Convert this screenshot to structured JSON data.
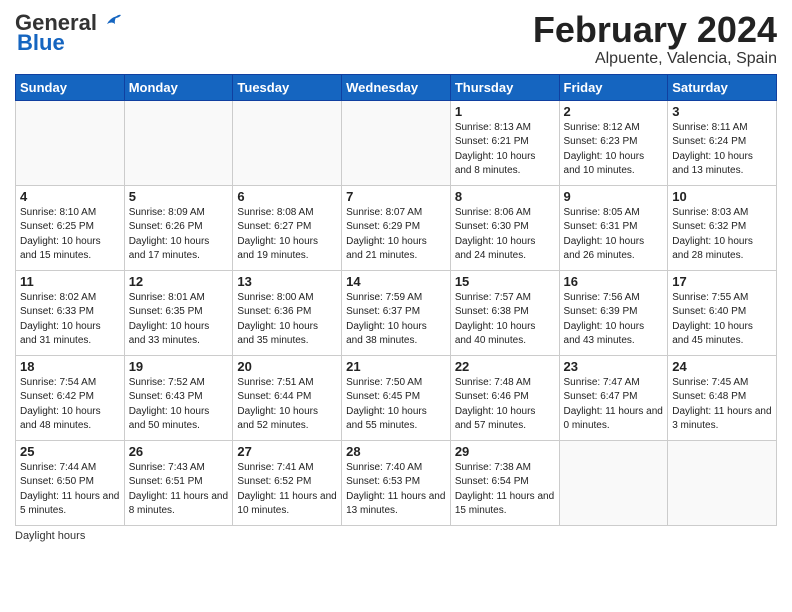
{
  "logo": {
    "general": "General",
    "blue": "Blue"
  },
  "title": "February 2024",
  "subtitle": "Alpuente, Valencia, Spain",
  "days_of_week": [
    "Sunday",
    "Monday",
    "Tuesday",
    "Wednesday",
    "Thursday",
    "Friday",
    "Saturday"
  ],
  "weeks": [
    [
      {
        "day": "",
        "info": ""
      },
      {
        "day": "",
        "info": ""
      },
      {
        "day": "",
        "info": ""
      },
      {
        "day": "",
        "info": ""
      },
      {
        "day": "1",
        "info": "Sunrise: 8:13 AM\nSunset: 6:21 PM\nDaylight: 10 hours and 8 minutes."
      },
      {
        "day": "2",
        "info": "Sunrise: 8:12 AM\nSunset: 6:23 PM\nDaylight: 10 hours and 10 minutes."
      },
      {
        "day": "3",
        "info": "Sunrise: 8:11 AM\nSunset: 6:24 PM\nDaylight: 10 hours and 13 minutes."
      }
    ],
    [
      {
        "day": "4",
        "info": "Sunrise: 8:10 AM\nSunset: 6:25 PM\nDaylight: 10 hours and 15 minutes."
      },
      {
        "day": "5",
        "info": "Sunrise: 8:09 AM\nSunset: 6:26 PM\nDaylight: 10 hours and 17 minutes."
      },
      {
        "day": "6",
        "info": "Sunrise: 8:08 AM\nSunset: 6:27 PM\nDaylight: 10 hours and 19 minutes."
      },
      {
        "day": "7",
        "info": "Sunrise: 8:07 AM\nSunset: 6:29 PM\nDaylight: 10 hours and 21 minutes."
      },
      {
        "day": "8",
        "info": "Sunrise: 8:06 AM\nSunset: 6:30 PM\nDaylight: 10 hours and 24 minutes."
      },
      {
        "day": "9",
        "info": "Sunrise: 8:05 AM\nSunset: 6:31 PM\nDaylight: 10 hours and 26 minutes."
      },
      {
        "day": "10",
        "info": "Sunrise: 8:03 AM\nSunset: 6:32 PM\nDaylight: 10 hours and 28 minutes."
      }
    ],
    [
      {
        "day": "11",
        "info": "Sunrise: 8:02 AM\nSunset: 6:33 PM\nDaylight: 10 hours and 31 minutes."
      },
      {
        "day": "12",
        "info": "Sunrise: 8:01 AM\nSunset: 6:35 PM\nDaylight: 10 hours and 33 minutes."
      },
      {
        "day": "13",
        "info": "Sunrise: 8:00 AM\nSunset: 6:36 PM\nDaylight: 10 hours and 35 minutes."
      },
      {
        "day": "14",
        "info": "Sunrise: 7:59 AM\nSunset: 6:37 PM\nDaylight: 10 hours and 38 minutes."
      },
      {
        "day": "15",
        "info": "Sunrise: 7:57 AM\nSunset: 6:38 PM\nDaylight: 10 hours and 40 minutes."
      },
      {
        "day": "16",
        "info": "Sunrise: 7:56 AM\nSunset: 6:39 PM\nDaylight: 10 hours and 43 minutes."
      },
      {
        "day": "17",
        "info": "Sunrise: 7:55 AM\nSunset: 6:40 PM\nDaylight: 10 hours and 45 minutes."
      }
    ],
    [
      {
        "day": "18",
        "info": "Sunrise: 7:54 AM\nSunset: 6:42 PM\nDaylight: 10 hours and 48 minutes."
      },
      {
        "day": "19",
        "info": "Sunrise: 7:52 AM\nSunset: 6:43 PM\nDaylight: 10 hours and 50 minutes."
      },
      {
        "day": "20",
        "info": "Sunrise: 7:51 AM\nSunset: 6:44 PM\nDaylight: 10 hours and 52 minutes."
      },
      {
        "day": "21",
        "info": "Sunrise: 7:50 AM\nSunset: 6:45 PM\nDaylight: 10 hours and 55 minutes."
      },
      {
        "day": "22",
        "info": "Sunrise: 7:48 AM\nSunset: 6:46 PM\nDaylight: 10 hours and 57 minutes."
      },
      {
        "day": "23",
        "info": "Sunrise: 7:47 AM\nSunset: 6:47 PM\nDaylight: 11 hours and 0 minutes."
      },
      {
        "day": "24",
        "info": "Sunrise: 7:45 AM\nSunset: 6:48 PM\nDaylight: 11 hours and 3 minutes."
      }
    ],
    [
      {
        "day": "25",
        "info": "Sunrise: 7:44 AM\nSunset: 6:50 PM\nDaylight: 11 hours and 5 minutes."
      },
      {
        "day": "26",
        "info": "Sunrise: 7:43 AM\nSunset: 6:51 PM\nDaylight: 11 hours and 8 minutes."
      },
      {
        "day": "27",
        "info": "Sunrise: 7:41 AM\nSunset: 6:52 PM\nDaylight: 11 hours and 10 minutes."
      },
      {
        "day": "28",
        "info": "Sunrise: 7:40 AM\nSunset: 6:53 PM\nDaylight: 11 hours and 13 minutes."
      },
      {
        "day": "29",
        "info": "Sunrise: 7:38 AM\nSunset: 6:54 PM\nDaylight: 11 hours and 15 minutes."
      },
      {
        "day": "",
        "info": ""
      },
      {
        "day": "",
        "info": ""
      }
    ]
  ],
  "footer": "Daylight hours"
}
